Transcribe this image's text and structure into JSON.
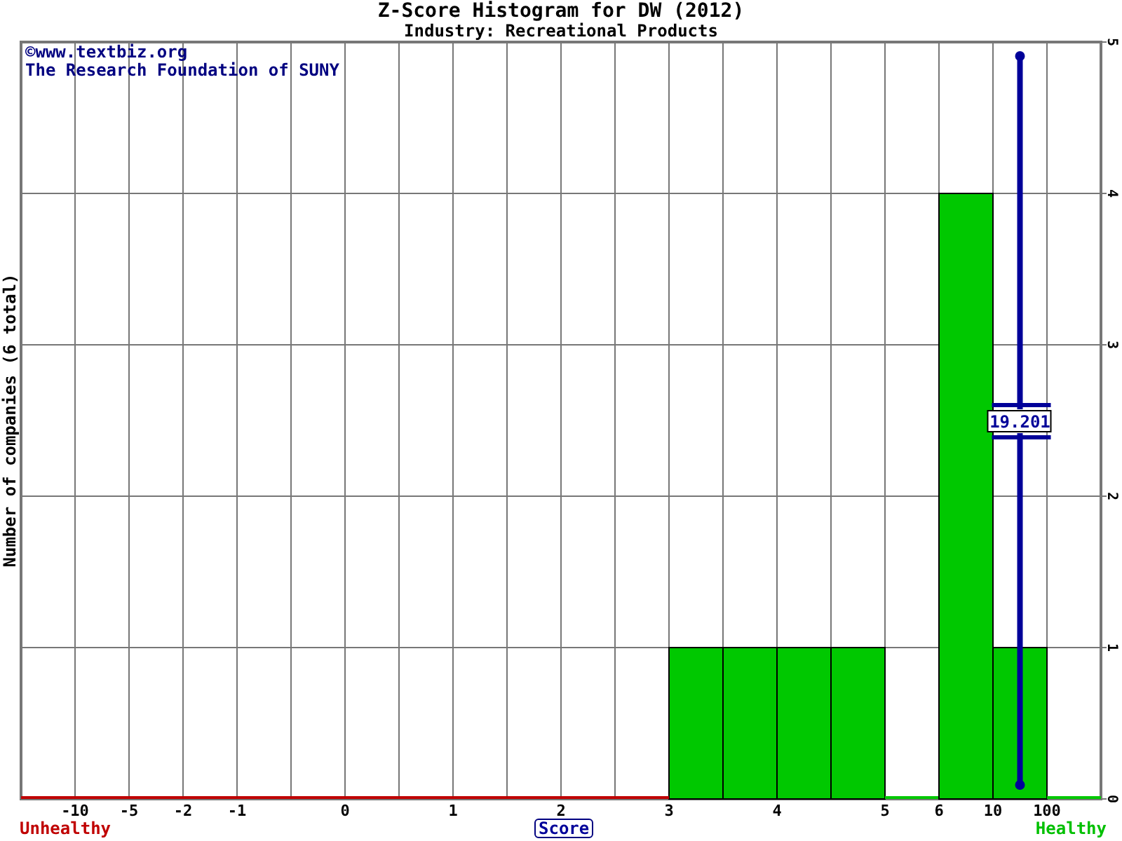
{
  "header": {
    "title": "Z-Score Histogram for DW (2012)",
    "subtitle": "Industry: Recreational Products"
  },
  "credits": [
    "©www.textbiz.org",
    "The Research Foundation of SUNY"
  ],
  "chart_data": {
    "type": "bar",
    "xlabel": "Score",
    "ylabel": "Number of companies (6 total)",
    "categories": [
      null,
      "-10",
      "-5",
      "-2",
      "-1",
      null,
      "0",
      null,
      "1",
      null,
      "2",
      null,
      "3",
      null,
      "4",
      null,
      "5",
      "6",
      "10",
      "100"
    ],
    "grid": true,
    "series": [
      {
        "color": "#00c800",
        "values": [
          0,
          0,
          0,
          0,
          0,
          0,
          0,
          0,
          0,
          0,
          0,
          0,
          1,
          1,
          1,
          1,
          0,
          4,
          1,
          0
        ]
      }
    ],
    "ylim": [
      0,
      5
    ],
    "yticks": [
      0,
      1,
      2,
      3,
      4,
      5
    ],
    "annotations": [
      {
        "text": "19.201",
        "x": "10"
      }
    ]
  },
  "scale_labels": [
    {
      "text": "Unhealthy",
      "color": "#c00000"
    },
    {
      "text": "Healthy",
      "color": "#00c000"
    }
  ]
}
